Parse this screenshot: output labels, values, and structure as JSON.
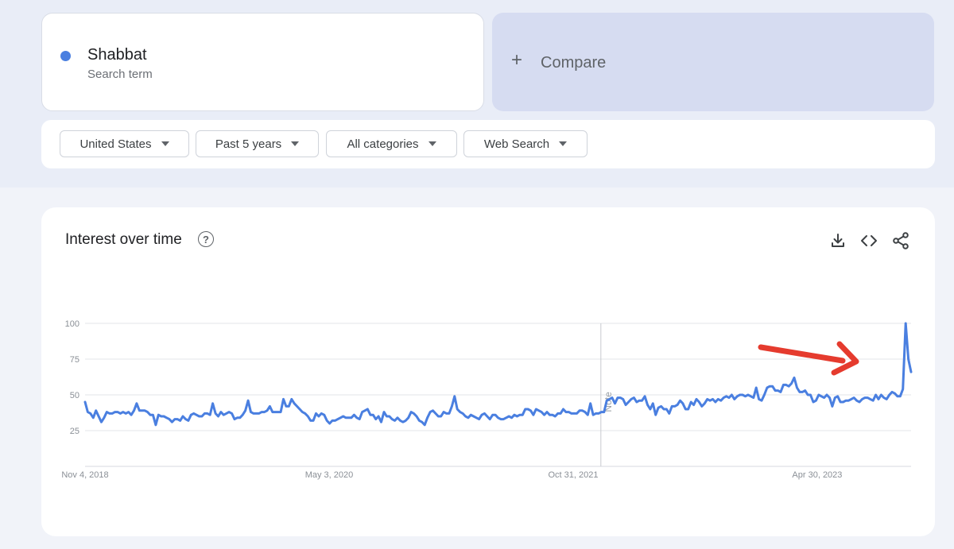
{
  "search_term": {
    "name": "Shabbat",
    "label": "Search term",
    "color": "#4a7fe0"
  },
  "compare": {
    "icon": "plus-icon",
    "label": "Compare"
  },
  "filters": [
    {
      "label": "United States"
    },
    {
      "label": "Past 5 years"
    },
    {
      "label": "All categories"
    },
    {
      "label": "Web Search"
    }
  ],
  "chart_panel": {
    "title": "Interest over time",
    "icons": [
      "help-icon",
      "download-icon",
      "embed-code-icon",
      "share-icon"
    ],
    "note_label": "Note",
    "annotation": "red-arrow-icon",
    "line_color": "#4a7fe0",
    "arrow_color": "#e53b2e"
  },
  "chart_data": {
    "type": "line",
    "title": "Interest over time",
    "xlabel": "",
    "ylabel": "",
    "ylim": [
      0,
      100
    ],
    "yticks": [
      25,
      50,
      75,
      100
    ],
    "xtick_labels": [
      "Nov 4, 2018",
      "May 3, 2020",
      "Oct 31, 2021",
      "Apr 30, 2023"
    ],
    "x_start": "2018-11-04",
    "x_end": "2023-11-26",
    "note_date": "2022-01-01",
    "grid": true,
    "series": [
      {
        "values": [
          45,
          38,
          37,
          34,
          39,
          35,
          31,
          34,
          38,
          37,
          37,
          38,
          38,
          37,
          38,
          37,
          38,
          36,
          39,
          44,
          39,
          39,
          39,
          38,
          36,
          36,
          29,
          36,
          35,
          35,
          34,
          33,
          31,
          33,
          33,
          32,
          35,
          33,
          32,
          36,
          37,
          36,
          35,
          35,
          37,
          37,
          36,
          44,
          37,
          35,
          38,
          36,
          37,
          38,
          37,
          33,
          34,
          34,
          36,
          39,
          46,
          38,
          37,
          37,
          37,
          38,
          38,
          39,
          42,
          38,
          38,
          38,
          38,
          47,
          42,
          42,
          47,
          44,
          42,
          40,
          38,
          37,
          35,
          32,
          32,
          37,
          35,
          37,
          36,
          32,
          30,
          32,
          32,
          33,
          34,
          35,
          34,
          34,
          34,
          36,
          34,
          33,
          38,
          39,
          40,
          36,
          36,
          33,
          35,
          31,
          38,
          35,
          35,
          33,
          32,
          34,
          32,
          31,
          32,
          34,
          38,
          37,
          35,
          32,
          31,
          29,
          34,
          38,
          39,
          37,
          35,
          35,
          38,
          37,
          37,
          42,
          49,
          40,
          38,
          37,
          35,
          34,
          36,
          35,
          34,
          33,
          36,
          37,
          35,
          33,
          36,
          36,
          34,
          33,
          33,
          34,
          35,
          34,
          36,
          35,
          36,
          36,
          40,
          40,
          39,
          36,
          40,
          39,
          38,
          36,
          38,
          36,
          36,
          35,
          37,
          37,
          40,
          38,
          38,
          37,
          37,
          37,
          39,
          39,
          38,
          36,
          44,
          36,
          37,
          37,
          38,
          38,
          46,
          47,
          48,
          44,
          48,
          48,
          47,
          43,
          45,
          47,
          48,
          45,
          46,
          46,
          49,
          43,
          40,
          44,
          36,
          41,
          42,
          40,
          40,
          37,
          42,
          42,
          43,
          46,
          44,
          40,
          40,
          45,
          43,
          47,
          45,
          42,
          44,
          47,
          46,
          47,
          45,
          47,
          46,
          48,
          49,
          48,
          50,
          47,
          49,
          50,
          50,
          49,
          50,
          49,
          48,
          55,
          47,
          46,
          50,
          55,
          56,
          56,
          53,
          53,
          52,
          57,
          57,
          56,
          58,
          62,
          55,
          52,
          52,
          53,
          50,
          50,
          45,
          46,
          50,
          49,
          48,
          50,
          48,
          42,
          48,
          49,
          45,
          45,
          46,
          46,
          47,
          48,
          46,
          45,
          47,
          48,
          48,
          47,
          46,
          50,
          47,
          50,
          48,
          47,
          50,
          52,
          51,
          49,
          49,
          54,
          100,
          75,
          66
        ]
      }
    ]
  }
}
